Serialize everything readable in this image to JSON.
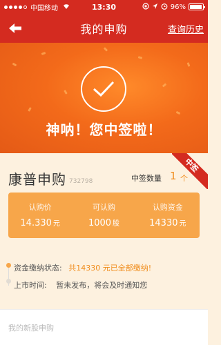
{
  "status": {
    "carrier": "中国移动",
    "time": "13:30",
    "battery": "96%",
    "battery_level": 0.96
  },
  "nav": {
    "title": "我的申购",
    "history": "查询历史"
  },
  "hero": {
    "message": "神呐！您中签啦！"
  },
  "stock": {
    "name": "康普申购",
    "code": "732798",
    "ribbon": "中签",
    "win_label": "中签数量",
    "win_count": "1",
    "win_unit": "个"
  },
  "stats": [
    {
      "label": "认购价",
      "value": "14.330",
      "unit": "元"
    },
    {
      "label": "可认购",
      "value": "1000",
      "unit": "股"
    },
    {
      "label": "认购资金",
      "value": "14330",
      "unit": "元"
    }
  ],
  "progress": {
    "fund_label": "资金缴纳状态:",
    "fund_value": "共14330 元已全部缴纳!",
    "listing_label": "上市时间:",
    "listing_value": "暂未发布，将会及时通知您"
  },
  "footer": {
    "link": "我的新股申购"
  },
  "colors": {
    "primary": "#d42b20",
    "accent": "#f08c1b",
    "panel": "#f7a64a"
  }
}
